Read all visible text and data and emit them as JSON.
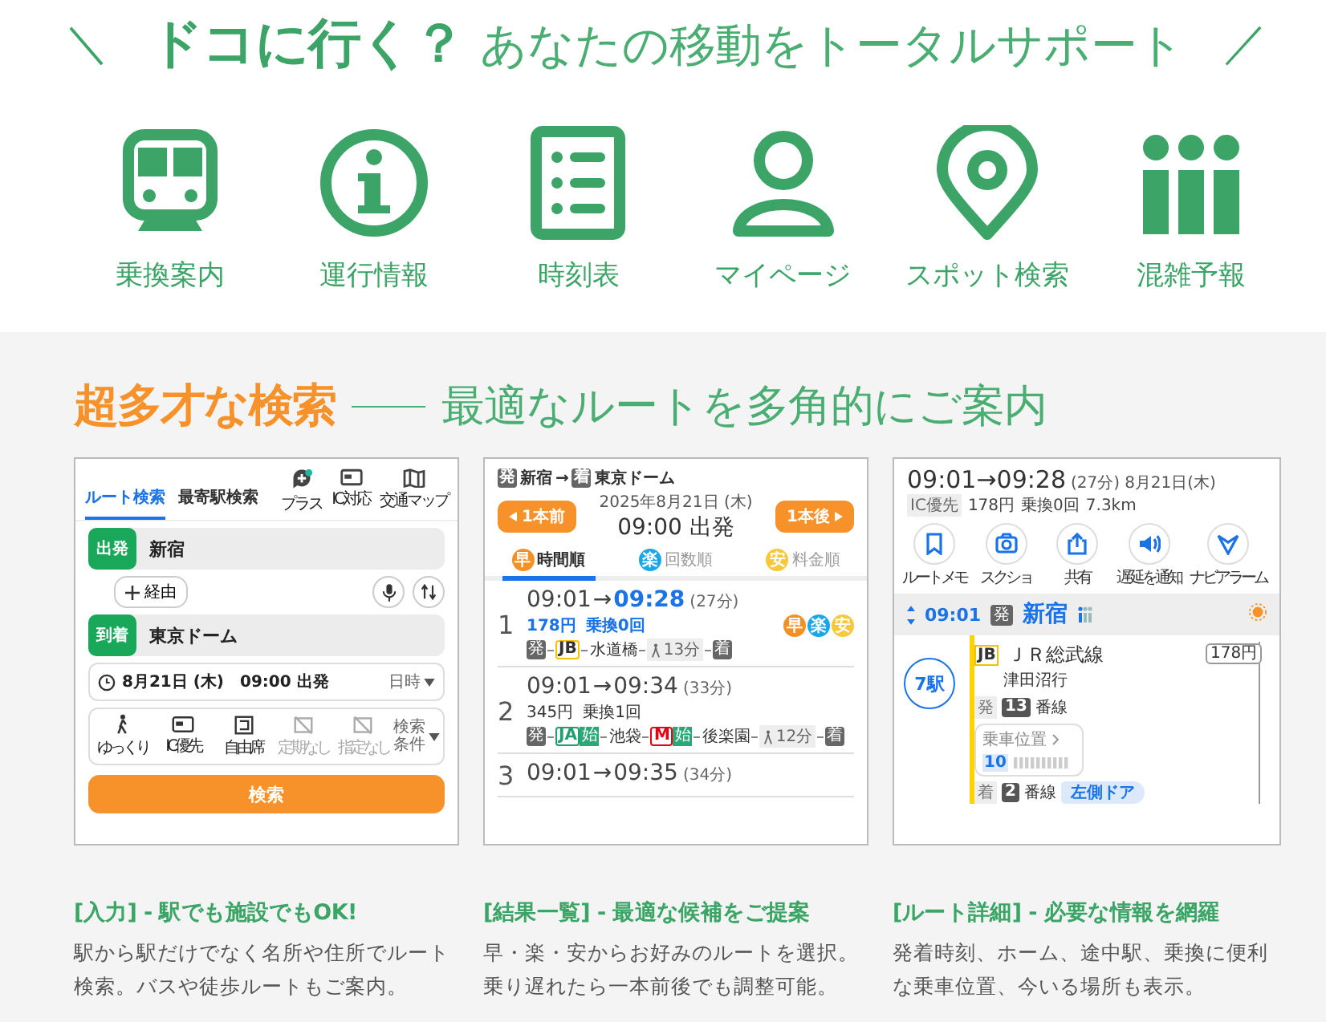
{
  "header": {
    "slash_left": "＼",
    "title_bold": "ドコに行く？",
    "title_rest": "あなたの移動をトータルサポート",
    "slash_right": "／"
  },
  "features": [
    {
      "kind": "train",
      "label": "乗換案内"
    },
    {
      "kind": "info",
      "label": "運行情報"
    },
    {
      "kind": "list",
      "label": "時刻表"
    },
    {
      "kind": "person",
      "label": "マイページ"
    },
    {
      "kind": "pin",
      "label": "スポット検索"
    },
    {
      "kind": "bars",
      "label": "混雑予報"
    }
  ],
  "section": {
    "title_accent": "超多才な検索",
    "title_rest": "最適なルートを多角的にご案内"
  },
  "search_screen": {
    "tabs": [
      {
        "label": "ルート検索",
        "selected": true
      },
      {
        "label": "最寄駅検索",
        "selected": false
      }
    ],
    "tools": [
      {
        "kind": "plus",
        "label": "プラス"
      },
      {
        "kind": "card",
        "label": "IC対応"
      },
      {
        "kind": "map",
        "label": "交通マップ"
      }
    ],
    "from": {
      "tag": "出発",
      "value": "新宿"
    },
    "via": "経由",
    "to": {
      "tag": "到着",
      "value": "東京ドーム"
    },
    "date": "8月21日 (木)　09:00 出発",
    "date_menu": "日時",
    "options": [
      {
        "kind": "walk",
        "label": "ゆっくり",
        "disabled": false
      },
      {
        "kind": "card",
        "label": "IC優先",
        "disabled": false
      },
      {
        "kind": "seat",
        "label": "自由席",
        "disabled": false
      },
      {
        "kind": "pass",
        "label": "定期なし",
        "disabled": true
      },
      {
        "kind": "pass",
        "label": "指定なし",
        "disabled": true
      }
    ],
    "conditions": "検索条件",
    "search_button": "検索"
  },
  "results_screen": {
    "from_tag": "発",
    "from": "新宿",
    "arrow": "→",
    "to_tag": "着",
    "to": "東京ドーム",
    "prev": "1本前",
    "date": "2025年8月21日 (木)",
    "time": "09:00 出発",
    "next": "1本後",
    "sorts": [
      {
        "icon": "早",
        "label": "時間順",
        "selected": true,
        "color": "#f39127"
      },
      {
        "icon": "楽",
        "label": "回数順",
        "selected": false,
        "color": "#1aa6e8"
      },
      {
        "icon": "安",
        "label": "料金順",
        "selected": false,
        "color": "#f7c83a"
      }
    ],
    "results": [
      {
        "index": "1",
        "depart": "09:01",
        "arrow": "→",
        "arrive": "09:28",
        "duration": "(27分)",
        "fastest": true,
        "fare": "178円",
        "transfers": "乗換0回",
        "badges": [
          {
            "text": "早",
            "color": "#f39127"
          },
          {
            "text": "楽",
            "color": "#1aa6e8"
          },
          {
            "text": "安",
            "color": "#f7c83a"
          }
        ],
        "route": [
          {
            "kind": "end",
            "text": "発"
          },
          {
            "kind": "line",
            "text": "JB",
            "color": "#f2c200"
          },
          {
            "kind": "station",
            "text": "水道橋"
          },
          {
            "kind": "walk",
            "text": "13分"
          },
          {
            "kind": "end",
            "text": "着"
          }
        ]
      },
      {
        "index": "2",
        "depart": "09:01",
        "arrow": "→",
        "arrive": "09:34",
        "duration": "(33分)",
        "fastest": false,
        "fare": "345円",
        "transfers": "乗換1回",
        "route": [
          {
            "kind": "end",
            "text": "発"
          },
          {
            "kind": "line",
            "text": "JA",
            "color": "#1f9e6e"
          },
          {
            "kind": "first",
            "text": "始"
          },
          {
            "kind": "station",
            "text": "池袋"
          },
          {
            "kind": "line",
            "text": "M",
            "color": "#e60012"
          },
          {
            "kind": "first",
            "text": "始"
          },
          {
            "kind": "station",
            "text": "後楽園"
          },
          {
            "kind": "walk",
            "text": "12分"
          },
          {
            "kind": "end",
            "text": "着"
          }
        ]
      },
      {
        "index": "3",
        "depart": "09:01",
        "arrow": "→",
        "arrive": "09:35",
        "duration": "(34分)",
        "fastest": false
      }
    ]
  },
  "detail_screen": {
    "time": "09:01→09:28",
    "duration": "(27分)",
    "date": "8月21日(木)",
    "tag": "IC優先",
    "fare": "178円",
    "transfers": "乗換0回",
    "distance": "7.3km",
    "actions": [
      {
        "kind": "bookmark",
        "label": "ルートメモ"
      },
      {
        "kind": "camera",
        "label": "スクショ"
      },
      {
        "kind": "share",
        "label": "共有"
      },
      {
        "kind": "speaker",
        "label": "遅延を通知"
      },
      {
        "kind": "navi",
        "label": "ナビアラーム"
      }
    ],
    "station": {
      "time": "09:01",
      "tag": "発",
      "name": "新宿"
    },
    "leg": {
      "stops": "7駅",
      "line_code": "JB",
      "line": "ＪＲ総武線",
      "direction": "津田沼行",
      "fare": "178円",
      "dep_tag": "発",
      "dep_track": "13",
      "dep_suffix": "番線",
      "position": "乗車位置",
      "car": "10",
      "arr_tag": "着",
      "arr_track": "2",
      "arr_suffix": "番線",
      "door": "左側ドア"
    }
  },
  "captions": [
    {
      "title": "[入力] - 駅でも施設でもOK!",
      "text": "駅から駅だけでなく名所や住所でルート検索。バスや徒歩ルートもご案内。"
    },
    {
      "title": "[結果一覧] - 最適な候補をご提案",
      "text": "早・楽・安からお好みのルートを選択。乗り遅れたら一本前後でも調整可能。"
    },
    {
      "title": "[ルート詳細] - 必要な情報を網羅",
      "text": "発着時刻、ホーム、途中駅、乗換に便利な乗車位置、今いる場所も表示。"
    }
  ]
}
